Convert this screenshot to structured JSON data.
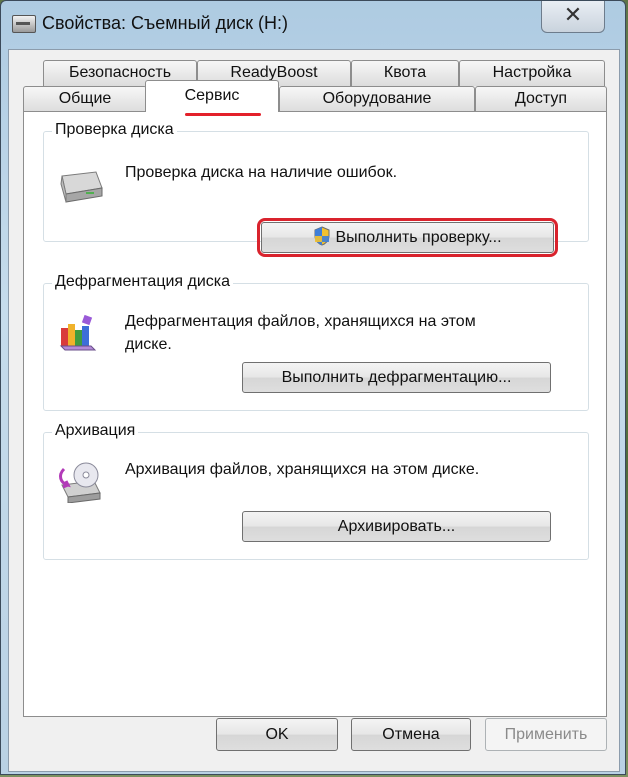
{
  "window": {
    "title": "Свойства: Съемный диск (H:)",
    "close_glyph": "✕"
  },
  "tabs": {
    "row1": [
      "Безопасность",
      "ReadyBoost",
      "Квота",
      "Настройка"
    ],
    "row2": [
      "Общие",
      "Сервис",
      "Оборудование",
      "Доступ"
    ],
    "active": "Сервис"
  },
  "groups": {
    "check": {
      "label": "Проверка диска",
      "description": "Проверка диска на наличие ошибок.",
      "button": "Выполнить проверку...",
      "icon": "drive-icon"
    },
    "defrag": {
      "label": "Дефрагментация диска",
      "description_line1": "Дефрагментация файлов, хранящихся на этом",
      "description_line2": "диске.",
      "button": "Выполнить дефрагментацию...",
      "icon": "defrag-icon"
    },
    "backup": {
      "label": "Архивация",
      "description": "Архивация файлов, хранящихся на этом диске.",
      "button": "Архивировать...",
      "icon": "backup-icon"
    }
  },
  "footer": {
    "ok": "OK",
    "cancel": "Отмена",
    "apply": "Применить"
  },
  "colors": {
    "highlight": "#d9232d",
    "tab_underline": "#e3202a"
  }
}
